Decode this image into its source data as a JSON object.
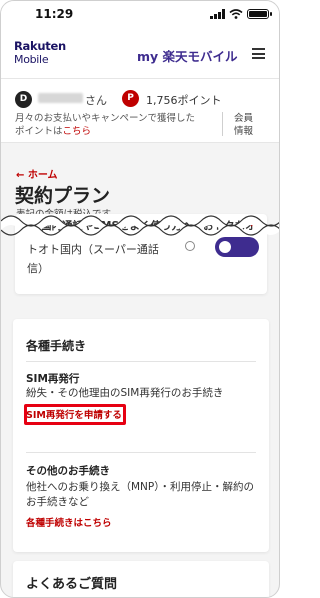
{
  "status_bar": {
    "time": "11:29"
  },
  "header": {
    "logo_line1": "Rakuten",
    "logo_line2": "Mobile",
    "brand": "my 楽天モバイル"
  },
  "account": {
    "rank_icon": "D",
    "honorific": "さん",
    "points_badge": "P",
    "points": "1,756ポイント",
    "note_prefix": "月々のお支払いやキャンペーンで獲得した",
    "note_line2": "ポイントは",
    "note_link": "こちら",
    "member_line1": "会員",
    "member_line2": "情報"
  },
  "page": {
    "back": "← ホーム",
    "title": "契約プラン",
    "subtitle": "表記の金額は税込です"
  },
  "banner": {
    "line1": "国内通話やSMSをよく使う方へ　おトクなオ",
    "close": "×",
    "line2": "トオト国内（スーパー通話",
    "line3": "信）"
  },
  "procedures": {
    "heading": "各種手続き",
    "sim": {
      "title": "SIM再発行",
      "desc": "紛失・その他理由のSIM再発行のお手続き",
      "link": "SIM再発行を申請する"
    },
    "other": {
      "title": "その他のお手続き",
      "desc": "他社へのお乗り換え（MNP）・利用停止・解約のお手続きなど",
      "link": "各種手続きはこちら"
    }
  },
  "faq": {
    "heading": "よくあるご質問"
  },
  "colors": {
    "accent": "#bf0000",
    "brand": "#3e2c8f",
    "highlight": "#e60012"
  }
}
